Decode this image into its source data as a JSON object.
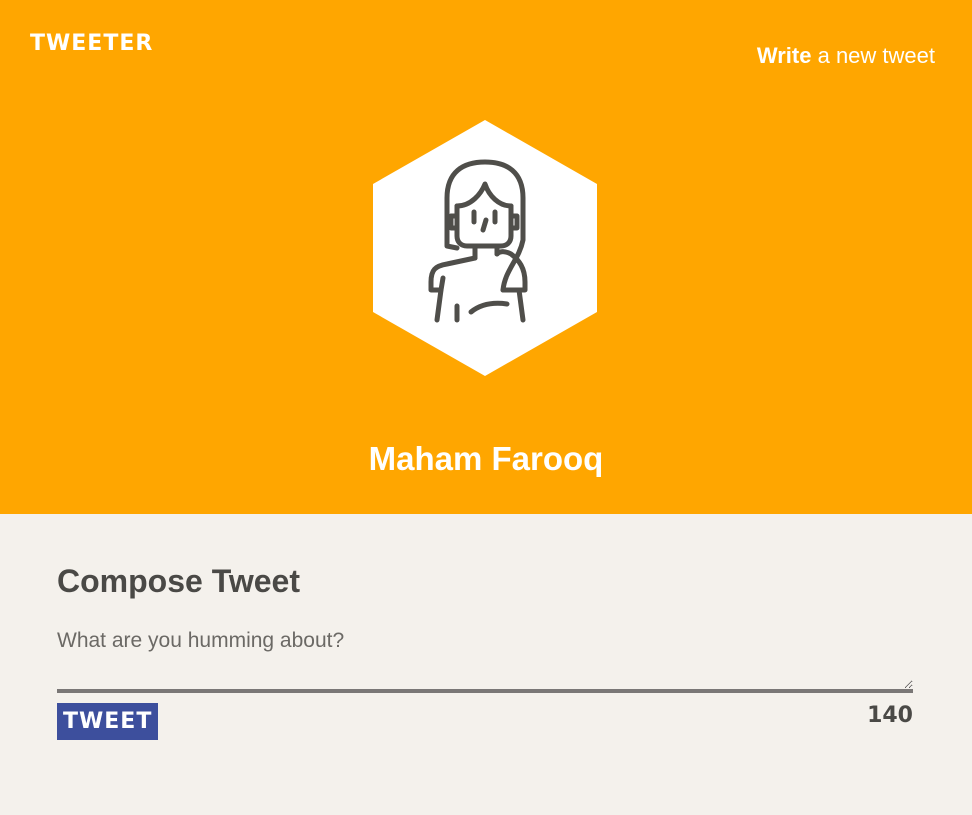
{
  "header": {
    "brand": "TWEETER",
    "write_link": {
      "strong": "Write",
      "rest": " a new tweet"
    },
    "user_name": "Maham Farooq",
    "avatar_icon": "female-user-avatar-icon"
  },
  "compose": {
    "title": "Compose Tweet",
    "input": {
      "placeholder": "What are you humming about?",
      "value": ""
    },
    "tweet_button_label": "TWEET",
    "char_counter": "140"
  },
  "colors": {
    "header_bg": "#ffa600",
    "page_bg": "#f4f1ec",
    "button_bg": "#3d4f9d",
    "text": "#4a4946"
  }
}
